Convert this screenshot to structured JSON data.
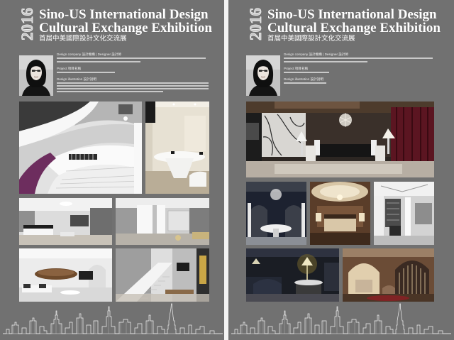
{
  "colors": {
    "poster_background": "#717171",
    "title": "#ffffff",
    "gap": "#f4f4f4"
  },
  "posters": [
    {
      "year": "2016",
      "title_line1": "Sino-US International Design",
      "title_line2": "Cultural Exchange Exhibition",
      "subtitle": "首屆中美國際設計文化交流展",
      "info": {
        "company_label": "Design company 設計機構 | Designer 設計師",
        "project_label": "Project 項目名稱",
        "illustration_label": "Design illustration 設計說明"
      }
    },
    {
      "year": "2016",
      "title_line1": "Sino-US International Design",
      "title_line2": "Cultural Exchange Exhibition",
      "subtitle": "首屆中美國際設計文化交流展",
      "info": {
        "company_label": "Design company 設計機構 | Designer 設計師",
        "project_label": "Project 項目名稱",
        "illustration_label": "Design illustration 設計說明"
      }
    }
  ]
}
